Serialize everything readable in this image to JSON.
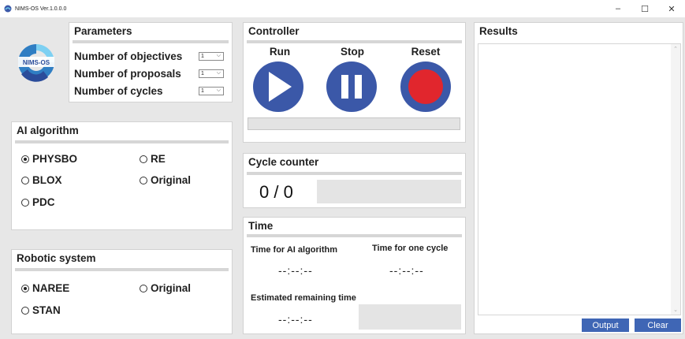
{
  "window": {
    "title": "NIMS-OS  Ver.1.0.0.0",
    "minimize": "–",
    "maximize": "☐",
    "close": "✕"
  },
  "logo": {
    "text": "NIMS-OS"
  },
  "parameters": {
    "title": "Parameters",
    "rows": [
      {
        "label": "Number of objectives",
        "value": "1"
      },
      {
        "label": "Number of proposals",
        "value": "1"
      },
      {
        "label": "Number of cycles",
        "value": "1"
      }
    ]
  },
  "ai_algorithm": {
    "title": "AI algorithm",
    "options": [
      {
        "label": "PHYSBO",
        "selected": true
      },
      {
        "label": "RE",
        "selected": false
      },
      {
        "label": "BLOX",
        "selected": false
      },
      {
        "label": "Original",
        "selected": false
      },
      {
        "label": "PDC",
        "selected": false
      }
    ]
  },
  "robotic_system": {
    "title": "Robotic system",
    "options": [
      {
        "label": "NAREE",
        "selected": true
      },
      {
        "label": "Original",
        "selected": false
      },
      {
        "label": "STAN",
        "selected": false
      }
    ]
  },
  "controller": {
    "title": "Controller",
    "run_label": "Run",
    "stop_label": "Stop",
    "reset_label": "Reset",
    "progress": 0
  },
  "cycle_counter": {
    "title": "Cycle counter",
    "value": "0 / 0"
  },
  "time": {
    "title": "Time",
    "ai_label": "Time for AI algorithm",
    "ai_value": "--:--:--",
    "cycle_label": "Time for one cycle",
    "cycle_value": "--:--:--",
    "remaining_label": "Estimated remaining time",
    "remaining_value": "--:--:--"
  },
  "results": {
    "title": "Results",
    "output_label": "Output",
    "clear_label": "Clear"
  },
  "colors": {
    "button_blue": "#3b58a8",
    "reset_red": "#e1262d",
    "action_blue": "#3f66b5"
  }
}
